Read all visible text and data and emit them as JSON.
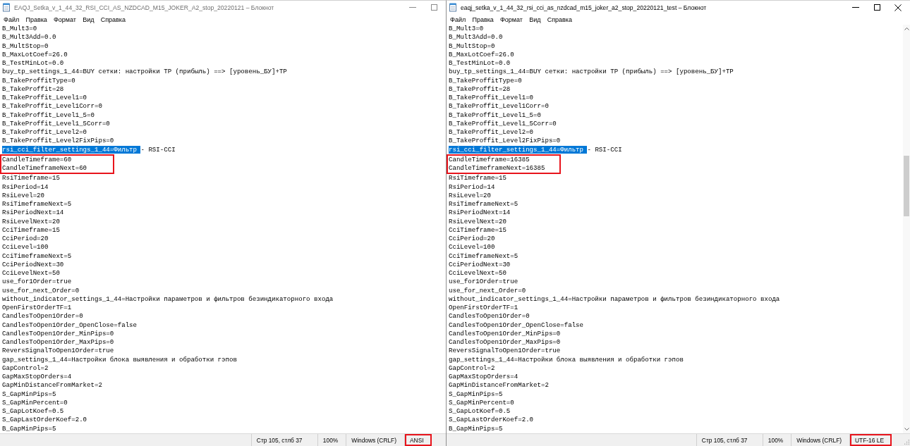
{
  "windows": [
    {
      "title": "EAQJ_Setka_v_1_44_32_RSI_CCI_AS_NZDCAD_M15_JOKER_A2_stop_20220121 – Блокнот",
      "active": false,
      "controls": [
        {
          "kind": "minimize"
        },
        {
          "kind": "maximize"
        }
      ],
      "menu": [
        "Файл",
        "Правка",
        "Формат",
        "Вид",
        "Справка"
      ],
      "editor": {
        "blocks": [
          {
            "kind": "plain",
            "lines": [
              "B_Mult3=0",
              "B_Mult3Add=0.0",
              "B_MultStop=0",
              "B_MaxLotCoef=26.0",
              "B_TestMinLot=0.0",
              "buy_tp_settings_1_44=BUY сетки: настройки TP (прибыль) ==> [уровень_БУ]+TP",
              "B_TakeProffitType=0",
              "B_TakeProffit=28",
              "B_TakeProffit_Level1=0",
              "B_TakeProffit_Level1Corr=0",
              "B_TakeProffit_Level1_5=0",
              "B_TakeProffit_Level1_5Corr=0",
              "B_TakeProffit_Level2=0",
              "B_TakeProffit_Level2FixPips=0"
            ]
          },
          {
            "kind": "selection",
            "segments": [
              {
                "text": "rsi_cci_filter_settings_1_44=Фильтр ",
                "selected": true
              },
              {
                "text": "- RSI-CCI",
                "selected": false
              }
            ]
          },
          {
            "kind": "outlined",
            "lines": [
              "CandleTimeframe=60",
              "CandleTimeframeNext=60"
            ]
          },
          {
            "kind": "plain",
            "lines": [
              "RsiTimeframe=15",
              "RsiPeriod=14",
              "RsiLevel=20",
              "RsiTimeframeNext=5",
              "RsiPeriodNext=14",
              "RsiLevelNext=20",
              "CciTimeframe=15",
              "CciPeriod=20",
              "CciLevel=100",
              "CciTimeframeNext=5",
              "CciPeriodNext=30",
              "CciLevelNext=50",
              "use_for1Order=true",
              "use_for_next_Order=0",
              "without_indicator_settings_1_44=Настройки параметров и фильтров безиндикаторного входа",
              "OpenFirstOrderTF=1",
              "CandlesToOpen1Order=0",
              "CandlesToOpen1Order_OpenClose=false",
              "CandlesToOpen1Order_MinPips=0",
              "CandlesToOpen1Order_MaxPips=0",
              "ReversSignalToOpen1Order=true",
              "gap_settings_1_44=Настройки блока выявления и обработки гэпов",
              "GapControl=2",
              "GapMaxStopOrders=4",
              "GapMinDistanceFromMarket=2",
              "S_GapMinPips=5",
              "S_GapMinPercent=0",
              "S_GapLotKoef=0.5",
              "S_GapLastOrderKoef=2.0",
              "B_GapMinPips=5"
            ]
          }
        ]
      },
      "scrollbar": false,
      "status_bar": [
        {
          "text": "Стр 105, стлб 37",
          "outlined": false
        },
        {
          "text": "100%",
          "outlined": false
        },
        {
          "text": "Windows (CRLF)",
          "outlined": false
        },
        {
          "text": "ANSI",
          "outlined": true
        }
      ]
    },
    {
      "title": "eaqj_setka_v_1_44_32_rsi_cci_as_nzdcad_m15_joker_a2_stop_20220121_test – Блокнот",
      "active": true,
      "controls": [
        {
          "kind": "minimize"
        },
        {
          "kind": "maximize"
        },
        {
          "kind": "close"
        }
      ],
      "menu": [
        "Файл",
        "Правка",
        "Формат",
        "Вид",
        "Справка"
      ],
      "editor": {
        "blocks": [
          {
            "kind": "plain",
            "lines": [
              "B_Mult3=0",
              "B_Mult3Add=0.0",
              "B_MultStop=0",
              "B_MaxLotCoef=26.0",
              "B_TestMinLot=0.0",
              "buy_tp_settings_1_44=BUY сетки: настройки TP (прибыль) ==> [уровень_БУ]+TP",
              "B_TakeProffitType=0",
              "B_TakeProffit=28",
              "B_TakeProffit_Level1=0",
              "B_TakeProffit_Level1Corr=0",
              "B_TakeProffit_Level1_5=0",
              "B_TakeProffit_Level1_5Corr=0",
              "B_TakeProffit_Level2=0",
              "B_TakeProffit_Level2FixPips=0"
            ]
          },
          {
            "kind": "selection",
            "segments": [
              {
                "text": "rsi_cci_filter_settings_1_44=Фильтр ",
                "selected": true
              },
              {
                "text": "- RSI-CCI",
                "selected": false
              }
            ]
          },
          {
            "kind": "outlined",
            "lines": [
              "CandleTimeframe=16385",
              "CandleTimeframeNext=16385"
            ]
          },
          {
            "kind": "plain",
            "lines": [
              "RsiTimeframe=15",
              "RsiPeriod=14",
              "RsiLevel=20",
              "RsiTimeframeNext=5",
              "RsiPeriodNext=14",
              "RsiLevelNext=20",
              "CciTimeframe=15",
              "CciPeriod=20",
              "CciLevel=100",
              "CciTimeframeNext=5",
              "CciPeriodNext=30",
              "CciLevelNext=50",
              "use_for1Order=true",
              "use_for_next_Order=0",
              "without_indicator_settings_1_44=Настройки параметров и фильтров безиндикаторного входа",
              "OpenFirstOrderTF=1",
              "CandlesToOpen1Order=0",
              "CandlesToOpen1Order_OpenClose=false",
              "CandlesToOpen1Order_MinPips=0",
              "CandlesToOpen1Order_MaxPips=0",
              "ReversSignalToOpen1Order=true",
              "gap_settings_1_44=Настройки блока выявления и обработки гэпов",
              "GapControl=2",
              "GapMaxStopOrders=4",
              "GapMinDistanceFromMarket=2",
              "S_GapMinPips=5",
              "S_GapMinPercent=0",
              "S_GapLotKoef=0.5",
              "S_GapLastOrderKoef=2.0",
              "B_GapMinPips=5"
            ]
          }
        ]
      },
      "scrollbar": true,
      "status_bar": [
        {
          "text": "Стр 105, стлб 37",
          "outlined": false
        },
        {
          "text": "100%",
          "outlined": false
        },
        {
          "text": "Windows (CRLF)",
          "outlined": false
        },
        {
          "text": "UTF-16 LE",
          "outlined": true
        }
      ]
    }
  ]
}
